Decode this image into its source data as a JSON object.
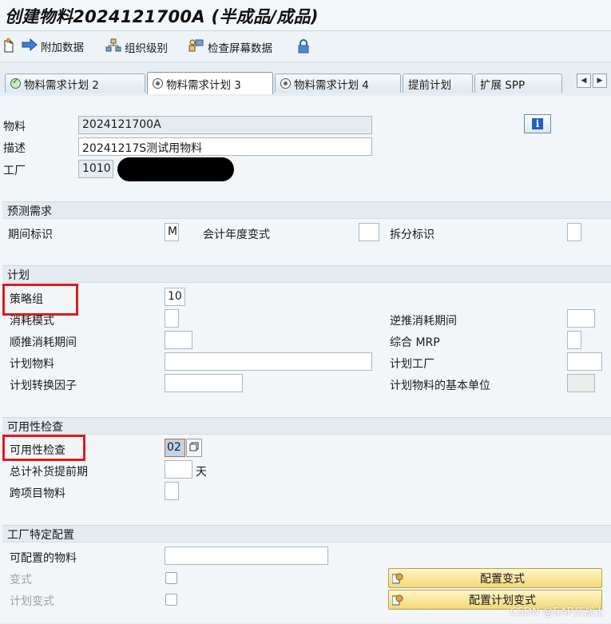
{
  "window": {
    "title": "创建物料2024121700A (半成品/成品)"
  },
  "toolbar": {
    "items": [
      {
        "label": "附加数据",
        "icon": "arrow-right-icon"
      },
      {
        "label": "组织级别",
        "icon": "org-levels-icon"
      },
      {
        "label": "检查屏幕数据",
        "icon": "check-screen-data-icon"
      }
    ]
  },
  "tabs": [
    {
      "label": "物料需求计划 2",
      "status": "ok"
    },
    {
      "label": "物料需求计划 3",
      "status": "active"
    },
    {
      "label": "物料需求计划 4",
      "status": "pending"
    },
    {
      "label": "提前计划"
    },
    {
      "label": "扩展 SPP"
    }
  ],
  "header": {
    "material_label": "物料",
    "material_value": "2024121700A",
    "desc_label": "描述",
    "desc_value": "20241217S测试用物料",
    "plant_label": "工厂",
    "plant_value": "1010"
  },
  "forecast": {
    "title": "预测需求",
    "period_label": "期间标识",
    "period_value": "M",
    "fiscal_variant_label": "会计年度变式",
    "split_label": "拆分标识"
  },
  "planning": {
    "title": "计划",
    "strategy_group_label": "策略组",
    "strategy_group_value": "10",
    "consumption_mode_label": "消耗模式",
    "bwd_period_label": "逆推消耗期间",
    "fwd_period_label": "顺推消耗期间",
    "mixed_mrp_label": "综合 MRP",
    "planning_material_label": "计划物料",
    "planning_plant_label": "计划工厂",
    "conv_factor_label": "计划转换因子",
    "base_unit_label": "计划物料的基本单位"
  },
  "availability": {
    "title": "可用性检查",
    "check_label": "可用性检查",
    "check_value": "02",
    "leadtime_label": "总计补货提前期",
    "leadtime_unit": "天",
    "cross_project_label": "跨项目物料"
  },
  "plant_config": {
    "title": "工厂特定配置",
    "configurable_label": "可配置的物料",
    "variant_label": "变式",
    "plan_variant_label": "计划变式",
    "config_variant_button": "配置变式",
    "config_plan_variant_button": "配置计划变式"
  },
  "watermark": "CSDN @SAP交战士",
  "colors": {
    "highlight_box": "#e01b1b",
    "button_yellow": "#f3d978",
    "section_bg": "#e3ebf1"
  }
}
